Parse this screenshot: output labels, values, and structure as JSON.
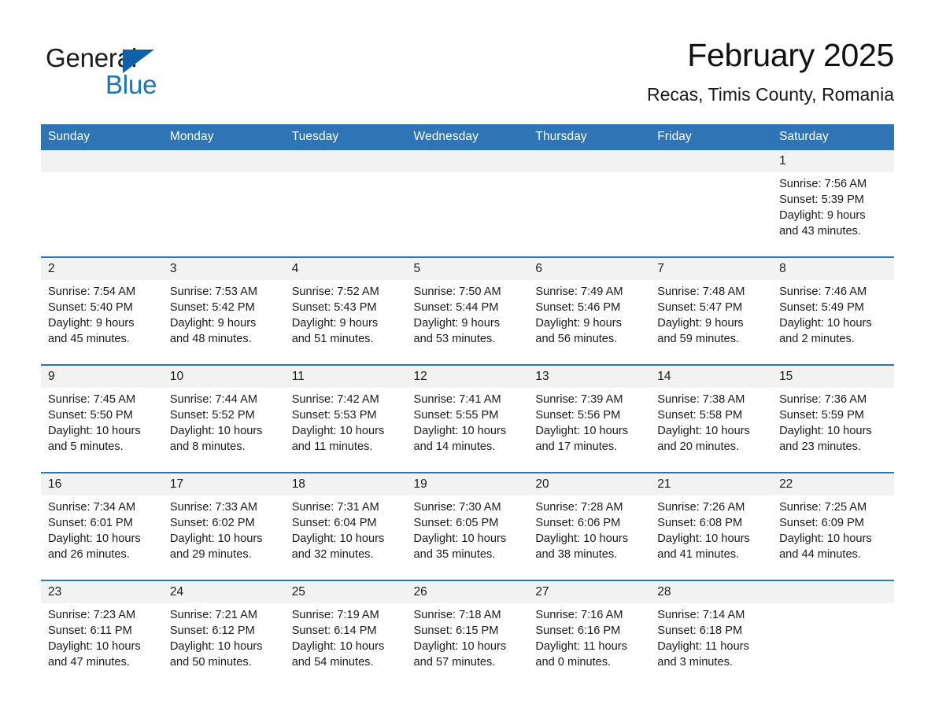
{
  "brand": {
    "name_part1": "General",
    "name_part2": "Blue",
    "triangle_color": "#1060a8",
    "blue_color": "#1473c4"
  },
  "header": {
    "title": "February 2025",
    "location": "Recas, Timis County, Romania"
  },
  "theme": {
    "header_blue": "#2f74b5",
    "row_divider_blue": "#2f74b5",
    "daynum_band": "#f2f2f2",
    "page_background": "#ffffff",
    "text": "#1a1a1a"
  },
  "weekday_headers": [
    "Sunday",
    "Monday",
    "Tuesday",
    "Wednesday",
    "Thursday",
    "Friday",
    "Saturday"
  ],
  "weeks": [
    [
      {
        "day": "",
        "empty": true,
        "sunrise": "",
        "sunset": "",
        "daylight_line1": "",
        "daylight_line2": ""
      },
      {
        "day": "",
        "empty": true,
        "sunrise": "",
        "sunset": "",
        "daylight_line1": "",
        "daylight_line2": ""
      },
      {
        "day": "",
        "empty": true,
        "sunrise": "",
        "sunset": "",
        "daylight_line1": "",
        "daylight_line2": ""
      },
      {
        "day": "",
        "empty": true,
        "sunrise": "",
        "sunset": "",
        "daylight_line1": "",
        "daylight_line2": ""
      },
      {
        "day": "",
        "empty": true,
        "sunrise": "",
        "sunset": "",
        "daylight_line1": "",
        "daylight_line2": ""
      },
      {
        "day": "",
        "empty": true,
        "sunrise": "",
        "sunset": "",
        "daylight_line1": "",
        "daylight_line2": ""
      },
      {
        "day": "1",
        "empty": false,
        "sunrise": "Sunrise: 7:56 AM",
        "sunset": "Sunset: 5:39 PM",
        "daylight_line1": "Daylight: 9 hours",
        "daylight_line2": "and 43 minutes."
      }
    ],
    [
      {
        "day": "2",
        "empty": false,
        "sunrise": "Sunrise: 7:54 AM",
        "sunset": "Sunset: 5:40 PM",
        "daylight_line1": "Daylight: 9 hours",
        "daylight_line2": "and 45 minutes."
      },
      {
        "day": "3",
        "empty": false,
        "sunrise": "Sunrise: 7:53 AM",
        "sunset": "Sunset: 5:42 PM",
        "daylight_line1": "Daylight: 9 hours",
        "daylight_line2": "and 48 minutes."
      },
      {
        "day": "4",
        "empty": false,
        "sunrise": "Sunrise: 7:52 AM",
        "sunset": "Sunset: 5:43 PM",
        "daylight_line1": "Daylight: 9 hours",
        "daylight_line2": "and 51 minutes."
      },
      {
        "day": "5",
        "empty": false,
        "sunrise": "Sunrise: 7:50 AM",
        "sunset": "Sunset: 5:44 PM",
        "daylight_line1": "Daylight: 9 hours",
        "daylight_line2": "and 53 minutes."
      },
      {
        "day": "6",
        "empty": false,
        "sunrise": "Sunrise: 7:49 AM",
        "sunset": "Sunset: 5:46 PM",
        "daylight_line1": "Daylight: 9 hours",
        "daylight_line2": "and 56 minutes."
      },
      {
        "day": "7",
        "empty": false,
        "sunrise": "Sunrise: 7:48 AM",
        "sunset": "Sunset: 5:47 PM",
        "daylight_line1": "Daylight: 9 hours",
        "daylight_line2": "and 59 minutes."
      },
      {
        "day": "8",
        "empty": false,
        "sunrise": "Sunrise: 7:46 AM",
        "sunset": "Sunset: 5:49 PM",
        "daylight_line1": "Daylight: 10 hours",
        "daylight_line2": "and 2 minutes."
      }
    ],
    [
      {
        "day": "9",
        "empty": false,
        "sunrise": "Sunrise: 7:45 AM",
        "sunset": "Sunset: 5:50 PM",
        "daylight_line1": "Daylight: 10 hours",
        "daylight_line2": "and 5 minutes."
      },
      {
        "day": "10",
        "empty": false,
        "sunrise": "Sunrise: 7:44 AM",
        "sunset": "Sunset: 5:52 PM",
        "daylight_line1": "Daylight: 10 hours",
        "daylight_line2": "and 8 minutes."
      },
      {
        "day": "11",
        "empty": false,
        "sunrise": "Sunrise: 7:42 AM",
        "sunset": "Sunset: 5:53 PM",
        "daylight_line1": "Daylight: 10 hours",
        "daylight_line2": "and 11 minutes."
      },
      {
        "day": "12",
        "empty": false,
        "sunrise": "Sunrise: 7:41 AM",
        "sunset": "Sunset: 5:55 PM",
        "daylight_line1": "Daylight: 10 hours",
        "daylight_line2": "and 14 minutes."
      },
      {
        "day": "13",
        "empty": false,
        "sunrise": "Sunrise: 7:39 AM",
        "sunset": "Sunset: 5:56 PM",
        "daylight_line1": "Daylight: 10 hours",
        "daylight_line2": "and 17 minutes."
      },
      {
        "day": "14",
        "empty": false,
        "sunrise": "Sunrise: 7:38 AM",
        "sunset": "Sunset: 5:58 PM",
        "daylight_line1": "Daylight: 10 hours",
        "daylight_line2": "and 20 minutes."
      },
      {
        "day": "15",
        "empty": false,
        "sunrise": "Sunrise: 7:36 AM",
        "sunset": "Sunset: 5:59 PM",
        "daylight_line1": "Daylight: 10 hours",
        "daylight_line2": "and 23 minutes."
      }
    ],
    [
      {
        "day": "16",
        "empty": false,
        "sunrise": "Sunrise: 7:34 AM",
        "sunset": "Sunset: 6:01 PM",
        "daylight_line1": "Daylight: 10 hours",
        "daylight_line2": "and 26 minutes."
      },
      {
        "day": "17",
        "empty": false,
        "sunrise": "Sunrise: 7:33 AM",
        "sunset": "Sunset: 6:02 PM",
        "daylight_line1": "Daylight: 10 hours",
        "daylight_line2": "and 29 minutes."
      },
      {
        "day": "18",
        "empty": false,
        "sunrise": "Sunrise: 7:31 AM",
        "sunset": "Sunset: 6:04 PM",
        "daylight_line1": "Daylight: 10 hours",
        "daylight_line2": "and 32 minutes."
      },
      {
        "day": "19",
        "empty": false,
        "sunrise": "Sunrise: 7:30 AM",
        "sunset": "Sunset: 6:05 PM",
        "daylight_line1": "Daylight: 10 hours",
        "daylight_line2": "and 35 minutes."
      },
      {
        "day": "20",
        "empty": false,
        "sunrise": "Sunrise: 7:28 AM",
        "sunset": "Sunset: 6:06 PM",
        "daylight_line1": "Daylight: 10 hours",
        "daylight_line2": "and 38 minutes."
      },
      {
        "day": "21",
        "empty": false,
        "sunrise": "Sunrise: 7:26 AM",
        "sunset": "Sunset: 6:08 PM",
        "daylight_line1": "Daylight: 10 hours",
        "daylight_line2": "and 41 minutes."
      },
      {
        "day": "22",
        "empty": false,
        "sunrise": "Sunrise: 7:25 AM",
        "sunset": "Sunset: 6:09 PM",
        "daylight_line1": "Daylight: 10 hours",
        "daylight_line2": "and 44 minutes."
      }
    ],
    [
      {
        "day": "23",
        "empty": false,
        "sunrise": "Sunrise: 7:23 AM",
        "sunset": "Sunset: 6:11 PM",
        "daylight_line1": "Daylight: 10 hours",
        "daylight_line2": "and 47 minutes."
      },
      {
        "day": "24",
        "empty": false,
        "sunrise": "Sunrise: 7:21 AM",
        "sunset": "Sunset: 6:12 PM",
        "daylight_line1": "Daylight: 10 hours",
        "daylight_line2": "and 50 minutes."
      },
      {
        "day": "25",
        "empty": false,
        "sunrise": "Sunrise: 7:19 AM",
        "sunset": "Sunset: 6:14 PM",
        "daylight_line1": "Daylight: 10 hours",
        "daylight_line2": "and 54 minutes."
      },
      {
        "day": "26",
        "empty": false,
        "sunrise": "Sunrise: 7:18 AM",
        "sunset": "Sunset: 6:15 PM",
        "daylight_line1": "Daylight: 10 hours",
        "daylight_line2": "and 57 minutes."
      },
      {
        "day": "27",
        "empty": false,
        "sunrise": "Sunrise: 7:16 AM",
        "sunset": "Sunset: 6:16 PM",
        "daylight_line1": "Daylight: 11 hours",
        "daylight_line2": "and 0 minutes."
      },
      {
        "day": "28",
        "empty": false,
        "sunrise": "Sunrise: 7:14 AM",
        "sunset": "Sunset: 6:18 PM",
        "daylight_line1": "Daylight: 11 hours",
        "daylight_line2": "and 3 minutes."
      },
      {
        "day": "",
        "empty": true,
        "sunrise": "",
        "sunset": "",
        "daylight_line1": "",
        "daylight_line2": ""
      }
    ]
  ]
}
